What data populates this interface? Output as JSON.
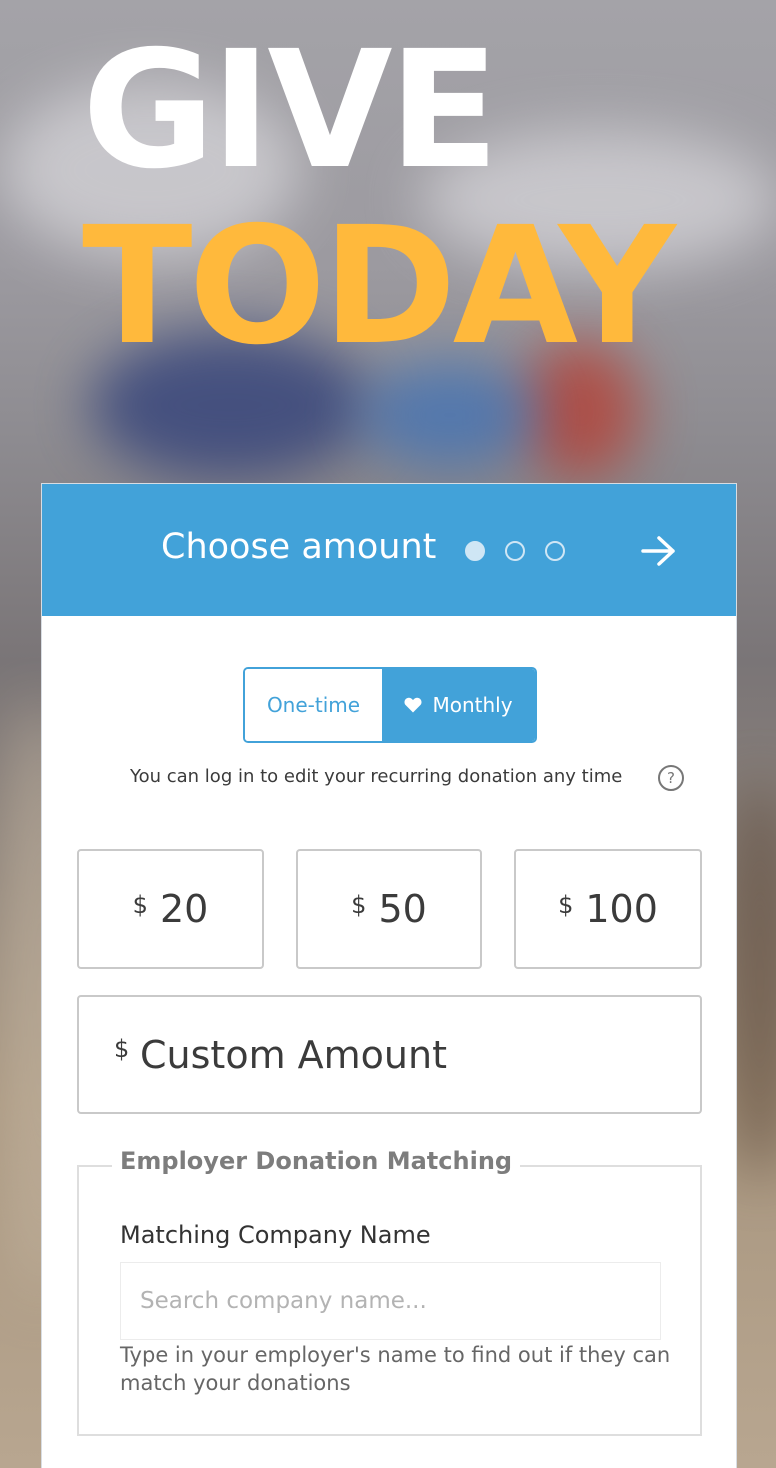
{
  "hero": {
    "line1": "GIVE",
    "line2": "TODAY",
    "line1_color": "#ffffff",
    "line2_color": "#ffb93c"
  },
  "header": {
    "step_title": "Choose amount",
    "steps_total": 3,
    "active_step": 1,
    "next_icon": "arrow-right-icon",
    "color": "#42a2d9"
  },
  "frequency": {
    "options": [
      "One-time",
      "Monthly"
    ],
    "selected": "Monthly",
    "monthly_icon": "heart-icon",
    "note": "You can log in to edit your recurring donation any time",
    "help_icon": "question-circle-icon",
    "help_glyph": "?"
  },
  "amounts": {
    "currency": "$",
    "presets": [
      "20",
      "50",
      "100"
    ],
    "custom_placeholder": "Custom Amount"
  },
  "matching": {
    "legend": "Employer Donation Matching",
    "label": "Matching Company Name",
    "input_placeholder": "Search company name...",
    "input_value": "",
    "help_text": "Type in your employer's name to find out if they can match your donations"
  }
}
